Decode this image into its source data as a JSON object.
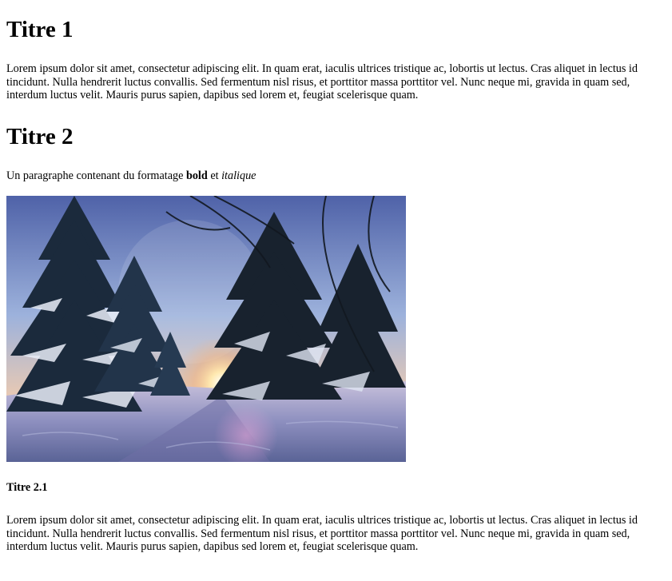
{
  "section1": {
    "heading": "Titre 1",
    "paragraph": "Lorem ipsum dolor sit amet, consectetur adipiscing elit. In quam erat, iaculis ultrices tristique ac, lobortis ut lectus. Cras aliquet in lectus id tincidunt. Nulla hendrerit luctus convallis. Sed fermentum nisl risus, et porttitor massa porttitor vel. Nunc neque mi, gravida in quam sed, interdum luctus velit. Mauris purus sapien, dapibus sed lorem et, feugiat scelerisque quam."
  },
  "section2": {
    "heading": "Titre 2",
    "paragraph_prefix": "Un paragraphe contenant du formatage ",
    "bold_text": "bold",
    "middle_text": " et ",
    "italic_text": "italique",
    "image_icon": "winter-forest-photo"
  },
  "section21": {
    "heading": "Titre 2.1",
    "paragraph": "Lorem ipsum dolor sit amet, consectetur adipiscing elit. In quam erat, iaculis ultrices tristique ac, lobortis ut lectus. Cras aliquet in lectus id tincidunt. Nulla hendrerit luctus convallis. Sed fermentum nisl risus, et porttitor massa porttitor vel. Nunc neque mi, gravida in quam sed, interdum luctus velit. Mauris purus sapien, dapibus sed lorem et, feugiat scelerisque quam."
  }
}
